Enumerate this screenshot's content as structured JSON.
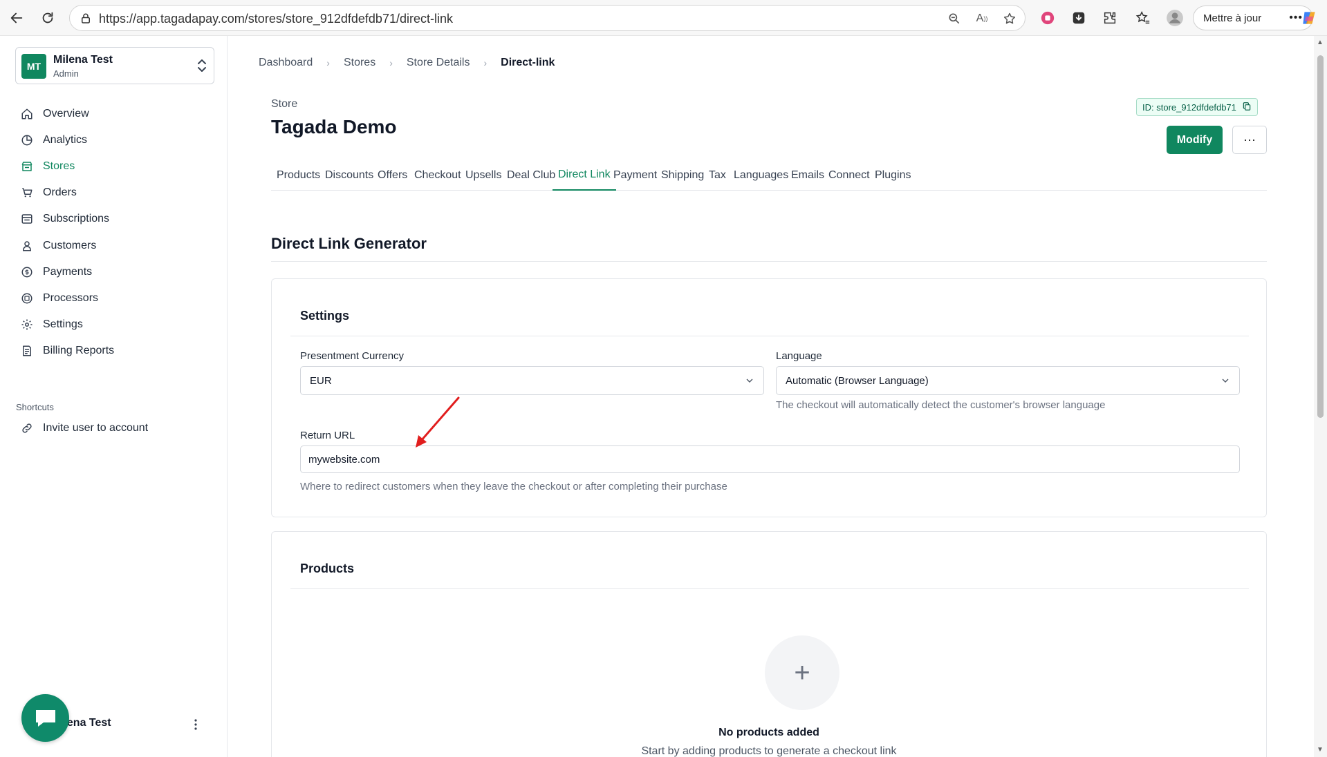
{
  "browser": {
    "url": "https://app.tagadapay.com/stores/store_912dfdefdb71/direct-link",
    "update_label": "Mettre à jour"
  },
  "account": {
    "initials": "MT",
    "name": "Milena Test",
    "role": "Admin"
  },
  "sidebar": {
    "items": [
      {
        "label": "Overview",
        "icon": "home-icon"
      },
      {
        "label": "Analytics",
        "icon": "pie-chart-icon"
      },
      {
        "label": "Stores",
        "icon": "store-icon",
        "active": true
      },
      {
        "label": "Orders",
        "icon": "cart-icon"
      },
      {
        "label": "Subscriptions",
        "icon": "subscriptions-icon"
      },
      {
        "label": "Customers",
        "icon": "user-icon"
      },
      {
        "label": "Payments",
        "icon": "coin-icon"
      },
      {
        "label": "Processors",
        "icon": "processor-icon"
      },
      {
        "label": "Settings",
        "icon": "gear-icon"
      },
      {
        "label": "Billing Reports",
        "icon": "report-icon"
      }
    ],
    "shortcuts_title": "Shortcuts",
    "shortcuts": [
      {
        "label": "Invite user to account",
        "icon": "link-icon"
      }
    ],
    "footer_user": "ilena Test"
  },
  "breadcrumb": [
    "Dashboard",
    "Stores",
    "Store Details",
    "Direct-link"
  ],
  "store": {
    "label": "Store",
    "title": "Tagada Demo",
    "id_badge": "ID: store_912dfdefdb71",
    "modify_label": "Modify",
    "more_label": "···"
  },
  "tabs": [
    "Products",
    "Discounts",
    "Offers",
    "Checkout",
    "Upsells",
    "Deal Club",
    "Direct Link",
    "Payment",
    "Shipping",
    "Tax",
    "Languages",
    "Emails",
    "Connect",
    "Plugins"
  ],
  "active_tab": "Direct Link",
  "generator": {
    "title": "Direct Link Generator",
    "settings": {
      "title": "Settings",
      "currency_label": "Presentment Currency",
      "currency_value": "EUR",
      "language_label": "Language",
      "language_value": "Automatic (Browser Language)",
      "language_help": "The checkout will automatically detect the customer's browser language",
      "return_url_label": "Return URL",
      "return_url_value": "mywebsite.com",
      "return_url_help": "Where to redirect customers when they leave the checkout or after completing their purchase"
    },
    "products": {
      "title": "Products",
      "empty_title": "No products added",
      "empty_sub": "Start by adding products to generate a checkout link"
    }
  },
  "colors": {
    "accent": "#10875f",
    "annotation_arrow": "#e11d1d"
  }
}
